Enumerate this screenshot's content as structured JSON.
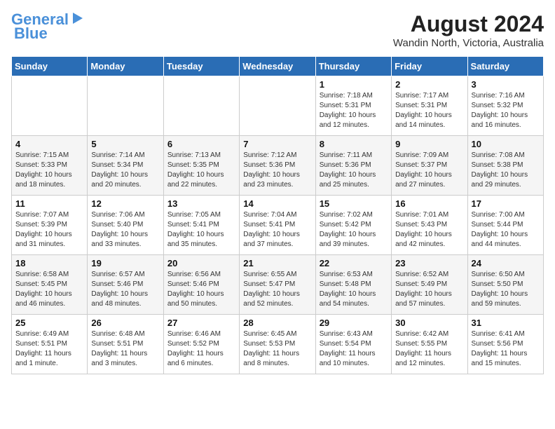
{
  "logo": {
    "line1": "General",
    "line2": "Blue"
  },
  "title": {
    "month_year": "August 2024",
    "location": "Wandin North, Victoria, Australia"
  },
  "days_of_week": [
    "Sunday",
    "Monday",
    "Tuesday",
    "Wednesday",
    "Thursday",
    "Friday",
    "Saturday"
  ],
  "weeks": [
    [
      {
        "day": "",
        "info": ""
      },
      {
        "day": "",
        "info": ""
      },
      {
        "day": "",
        "info": ""
      },
      {
        "day": "",
        "info": ""
      },
      {
        "day": "1",
        "info": "Sunrise: 7:18 AM\nSunset: 5:31 PM\nDaylight: 10 hours\nand 12 minutes."
      },
      {
        "day": "2",
        "info": "Sunrise: 7:17 AM\nSunset: 5:31 PM\nDaylight: 10 hours\nand 14 minutes."
      },
      {
        "day": "3",
        "info": "Sunrise: 7:16 AM\nSunset: 5:32 PM\nDaylight: 10 hours\nand 16 minutes."
      }
    ],
    [
      {
        "day": "4",
        "info": "Sunrise: 7:15 AM\nSunset: 5:33 PM\nDaylight: 10 hours\nand 18 minutes."
      },
      {
        "day": "5",
        "info": "Sunrise: 7:14 AM\nSunset: 5:34 PM\nDaylight: 10 hours\nand 20 minutes."
      },
      {
        "day": "6",
        "info": "Sunrise: 7:13 AM\nSunset: 5:35 PM\nDaylight: 10 hours\nand 22 minutes."
      },
      {
        "day": "7",
        "info": "Sunrise: 7:12 AM\nSunset: 5:36 PM\nDaylight: 10 hours\nand 23 minutes."
      },
      {
        "day": "8",
        "info": "Sunrise: 7:11 AM\nSunset: 5:36 PM\nDaylight: 10 hours\nand 25 minutes."
      },
      {
        "day": "9",
        "info": "Sunrise: 7:09 AM\nSunset: 5:37 PM\nDaylight: 10 hours\nand 27 minutes."
      },
      {
        "day": "10",
        "info": "Sunrise: 7:08 AM\nSunset: 5:38 PM\nDaylight: 10 hours\nand 29 minutes."
      }
    ],
    [
      {
        "day": "11",
        "info": "Sunrise: 7:07 AM\nSunset: 5:39 PM\nDaylight: 10 hours\nand 31 minutes."
      },
      {
        "day": "12",
        "info": "Sunrise: 7:06 AM\nSunset: 5:40 PM\nDaylight: 10 hours\nand 33 minutes."
      },
      {
        "day": "13",
        "info": "Sunrise: 7:05 AM\nSunset: 5:41 PM\nDaylight: 10 hours\nand 35 minutes."
      },
      {
        "day": "14",
        "info": "Sunrise: 7:04 AM\nSunset: 5:41 PM\nDaylight: 10 hours\nand 37 minutes."
      },
      {
        "day": "15",
        "info": "Sunrise: 7:02 AM\nSunset: 5:42 PM\nDaylight: 10 hours\nand 39 minutes."
      },
      {
        "day": "16",
        "info": "Sunrise: 7:01 AM\nSunset: 5:43 PM\nDaylight: 10 hours\nand 42 minutes."
      },
      {
        "day": "17",
        "info": "Sunrise: 7:00 AM\nSunset: 5:44 PM\nDaylight: 10 hours\nand 44 minutes."
      }
    ],
    [
      {
        "day": "18",
        "info": "Sunrise: 6:58 AM\nSunset: 5:45 PM\nDaylight: 10 hours\nand 46 minutes."
      },
      {
        "day": "19",
        "info": "Sunrise: 6:57 AM\nSunset: 5:46 PM\nDaylight: 10 hours\nand 48 minutes."
      },
      {
        "day": "20",
        "info": "Sunrise: 6:56 AM\nSunset: 5:46 PM\nDaylight: 10 hours\nand 50 minutes."
      },
      {
        "day": "21",
        "info": "Sunrise: 6:55 AM\nSunset: 5:47 PM\nDaylight: 10 hours\nand 52 minutes."
      },
      {
        "day": "22",
        "info": "Sunrise: 6:53 AM\nSunset: 5:48 PM\nDaylight: 10 hours\nand 54 minutes."
      },
      {
        "day": "23",
        "info": "Sunrise: 6:52 AM\nSunset: 5:49 PM\nDaylight: 10 hours\nand 57 minutes."
      },
      {
        "day": "24",
        "info": "Sunrise: 6:50 AM\nSunset: 5:50 PM\nDaylight: 10 hours\nand 59 minutes."
      }
    ],
    [
      {
        "day": "25",
        "info": "Sunrise: 6:49 AM\nSunset: 5:51 PM\nDaylight: 11 hours\nand 1 minute."
      },
      {
        "day": "26",
        "info": "Sunrise: 6:48 AM\nSunset: 5:51 PM\nDaylight: 11 hours\nand 3 minutes."
      },
      {
        "day": "27",
        "info": "Sunrise: 6:46 AM\nSunset: 5:52 PM\nDaylight: 11 hours\nand 6 minutes."
      },
      {
        "day": "28",
        "info": "Sunrise: 6:45 AM\nSunset: 5:53 PM\nDaylight: 11 hours\nand 8 minutes."
      },
      {
        "day": "29",
        "info": "Sunrise: 6:43 AM\nSunset: 5:54 PM\nDaylight: 11 hours\nand 10 minutes."
      },
      {
        "day": "30",
        "info": "Sunrise: 6:42 AM\nSunset: 5:55 PM\nDaylight: 11 hours\nand 12 minutes."
      },
      {
        "day": "31",
        "info": "Sunrise: 6:41 AM\nSunset: 5:56 PM\nDaylight: 11 hours\nand 15 minutes."
      }
    ]
  ]
}
